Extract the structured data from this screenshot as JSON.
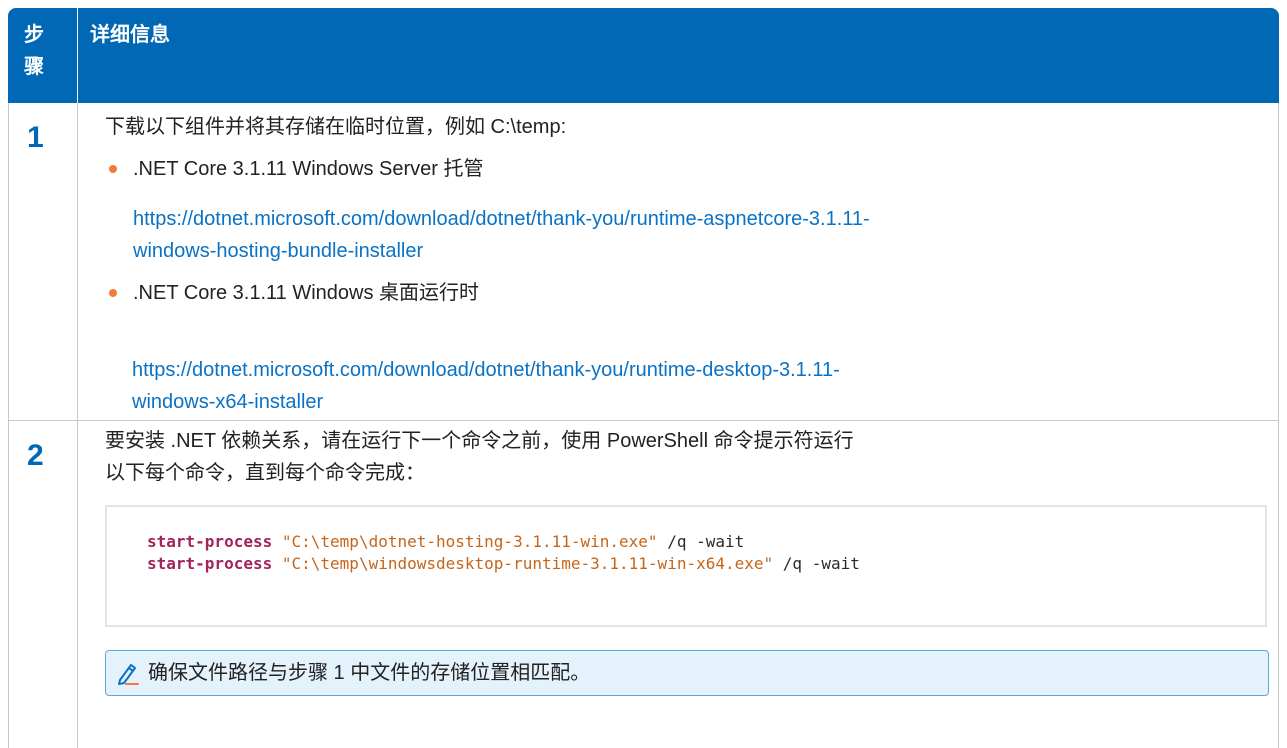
{
  "header": {
    "step_label": "步骤",
    "details_label": "详细信息"
  },
  "steps": [
    {
      "number": "1",
      "intro": "下载以下组件并将其存储在临时位置，例如 C:\\temp:",
      "items": [
        {
          "title": ".NET Core 3.1.11 Windows Server 托管",
          "link_line1": "https://dotnet.microsoft.com/download/dotnet/thank-you/runtime-aspnetcore-3.1.11-",
          "link_line2": "windows-hosting-bundle-installer"
        },
        {
          "title": ".NET Core 3.1.11 Windows 桌面运行时",
          "link_line1": "https://dotnet.microsoft.com/download/dotnet/thank-you/runtime-desktop-3.1.11-",
          "link_line2": "windows-x64-installer"
        }
      ]
    },
    {
      "number": "2",
      "intro_line1": "要安装 .NET 依赖关系，请在运行下一个命令之前，使用 PowerShell 命令提示符运行",
      "intro_line2": "以下每个命令，直到每个命令完成：",
      "code": [
        {
          "cmd": "start-process",
          "arg": "\"C:\\temp\\dotnet-hosting-3.1.11-win.exe\"",
          "flags": "/q -wait"
        },
        {
          "cmd": "start-process",
          "arg": "\"C:\\temp\\windowsdesktop-runtime-3.1.11-win-x64.exe\"",
          "flags": "/q -wait"
        }
      ],
      "note": "确保文件路径与步骤 1 中文件的存储位置相匹配。",
      "note_icon": "pencil-icon"
    }
  ],
  "colors": {
    "header_bg": "#0068b4",
    "step_number": "#0068b4",
    "link": "#0a72c5",
    "bullet": "#f27a3b",
    "keyword": "#a3235a",
    "string": "#c5651a",
    "note_bg": "#e4f2fc",
    "note_border": "#5aa9dc"
  }
}
